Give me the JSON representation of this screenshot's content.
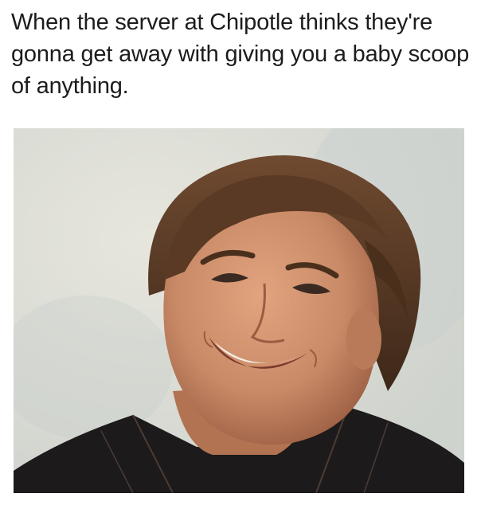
{
  "caption": {
    "text": "When the server at Chipotle thinks they're gonna get away with giving you a baby scoop of anything."
  },
  "photo": {
    "subject": "smiling-man-portrait",
    "colors": {
      "background": "#dcddd6",
      "skin": "#c98a67",
      "hair": "#5a3a24",
      "jacket": "#1d1a1c"
    }
  }
}
